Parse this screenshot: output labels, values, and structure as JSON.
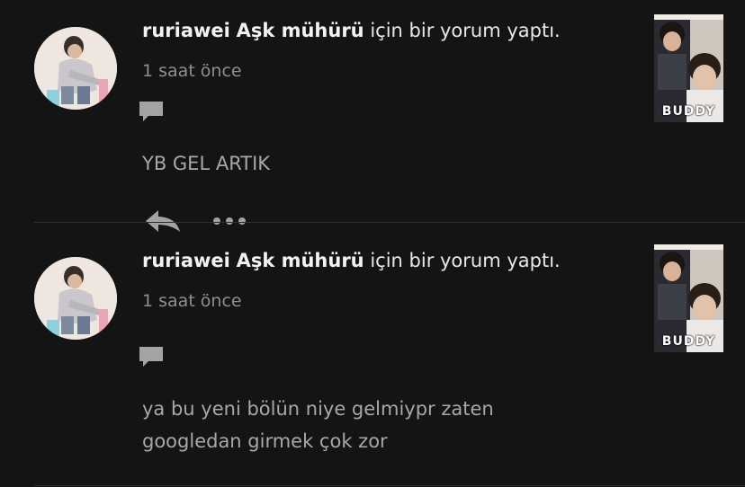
{
  "notifications": [
    {
      "user": "ruriawei",
      "story": "Aşk mühürü",
      "action": "için bir yorum yaptı.",
      "time": "1 saat önce",
      "comment": "YB GEL ARTIK",
      "cover_title": "BUDDY"
    },
    {
      "user": "ruriawei",
      "story": "Aşk mühürü",
      "action": "için bir yorum yaptı.",
      "time": "1 saat önce",
      "comment_lines": [
        "ya bu yeni bölün niye gelmiypr zaten",
        "googledan girmek çok zor"
      ],
      "cover_title": "BUDDY"
    }
  ],
  "icons": {
    "comment": "speech-bubble-icon",
    "reply": "reply-arrow-icon",
    "more": "more-dots-icon"
  },
  "colors": {
    "background": "#141414",
    "headline": "#e8e8e8",
    "muted": "#8f8f8f",
    "icon": "#a3a3a3"
  }
}
